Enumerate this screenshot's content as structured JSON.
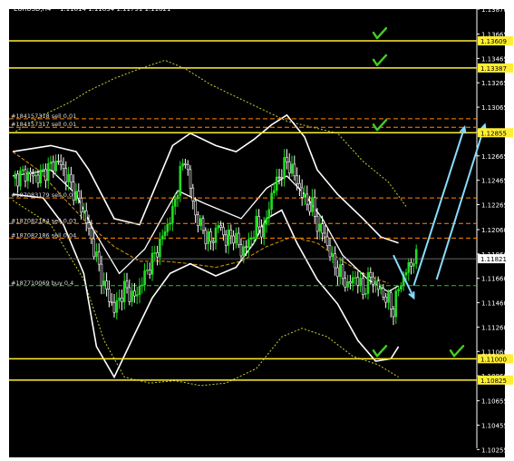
{
  "header": {
    "symbol": "EURUSD,H4",
    "ohlc": "1.11814 1.11834 1.11791 1.11821"
  },
  "colors": {
    "background": "#000000",
    "bull_candle": "#22dd22",
    "bear_candle": "#ffffff",
    "level_line": "#ffee33",
    "order_line_sell": "#ff8800",
    "order_line_buy": "#33bb33",
    "band_main": "#ffffff",
    "band_outer": "#cccc33",
    "moving_average": "#dd9900",
    "arrow": "#88ddff",
    "check": "#44cc22",
    "price_tag": "#ffee33",
    "current_tag": "#ffffff"
  },
  "chart_data": {
    "type": "candlestick",
    "symbol": "EURUSD",
    "timeframe": "H4",
    "grid": false,
    "ylim": [
      1.10265,
      1.1387
    ],
    "y_ticks": [
      "1.13870",
      "1.13665",
      "1.13465",
      "1.13265",
      "1.13065",
      "1.12865",
      "1.12665",
      "1.12465",
      "1.12265",
      "1.12060",
      "1.11860",
      "1.11660",
      "1.11460",
      "1.11260",
      "1.11060",
      "1.10860",
      "1.10655",
      "1.10455",
      "1.10255"
    ],
    "horizontal_levels": [
      {
        "label": "1.13609",
        "price": 1.13609,
        "checked": true
      },
      {
        "label": "1.13387",
        "price": 1.13387,
        "checked": true
      },
      {
        "label": "1.12855",
        "price": 1.12855,
        "checked": true
      },
      {
        "label": "1.11000",
        "price": 1.11,
        "checked": true
      },
      {
        "label": "1.10825",
        "price": 1.10825,
        "checked": false
      }
    ],
    "current_price": {
      "label": "1.11821",
      "price": 1.11821
    },
    "orders": [
      {
        "label": "#184157318 sell 0.01",
        "price": 1.1297
      },
      {
        "label": "#184157317 sell 0.01",
        "price": 1.129
      },
      {
        "label": "#187083179 sell 0.02",
        "price": 1.1232
      },
      {
        "label": "#187082184 sell 0.03",
        "price": 1.1211
      },
      {
        "label": "#187082186 sell 0.04",
        "price": 1.1199
      },
      {
        "label": "#187710069 buy 0.4",
        "price": 1.116
      }
    ],
    "close_path": [
      [
        0,
        1.1248
      ],
      [
        5,
        1.1252
      ],
      [
        10,
        1.1249
      ],
      [
        15,
        1.1258
      ],
      [
        18,
        1.1262
      ],
      [
        20,
        1.1255
      ],
      [
        24,
        1.1238
      ],
      [
        28,
        1.122
      ],
      [
        32,
        1.119
      ],
      [
        36,
        1.116
      ],
      [
        40,
        1.114
      ],
      [
        44,
        1.1158
      ],
      [
        48,
        1.115
      ],
      [
        52,
        1.1168
      ],
      [
        56,
        1.1185
      ],
      [
        60,
        1.1205
      ],
      [
        63,
        1.122
      ],
      [
        66,
        1.1252
      ],
      [
        68,
        1.1265
      ],
      [
        70,
        1.124
      ],
      [
        72,
        1.1218
      ],
      [
        75,
        1.1205
      ],
      [
        78,
        1.1195
      ],
      [
        81,
        1.121
      ],
      [
        84,
        1.1198
      ],
      [
        87,
        1.1202
      ],
      [
        90,
        1.1188
      ],
      [
        93,
        1.1195
      ],
      [
        96,
        1.121
      ],
      [
        99,
        1.1205
      ],
      [
        102,
        1.1235
      ],
      [
        105,
        1.125
      ],
      [
        108,
        1.1262
      ],
      [
        110,
        1.1255
      ],
      [
        112,
        1.1245
      ],
      [
        115,
        1.123
      ],
      [
        118,
        1.1225
      ],
      [
        120,
        1.121
      ],
      [
        123,
        1.12
      ],
      [
        126,
        1.118
      ],
      [
        129,
        1.117
      ],
      [
        132,
        1.116
      ],
      [
        135,
        1.1168
      ],
      [
        138,
        1.1155
      ],
      [
        141,
        1.1168
      ],
      [
        144,
        1.1158
      ],
      [
        147,
        1.115
      ],
      [
        150,
        1.114
      ],
      [
        152,
        1.1158
      ],
      [
        155,
        1.1172
      ],
      [
        158,
        1.1182
      ]
    ],
    "band_upper": [
      [
        0,
        1.127
      ],
      [
        15,
        1.1275
      ],
      [
        25,
        1.127
      ],
      [
        30,
        1.1255
      ],
      [
        40,
        1.1215
      ],
      [
        50,
        1.121
      ],
      [
        58,
        1.125
      ],
      [
        63,
        1.1275
      ],
      [
        70,
        1.1285
      ],
      [
        80,
        1.1275
      ],
      [
        88,
        1.127
      ],
      [
        95,
        1.128
      ],
      [
        102,
        1.1292
      ],
      [
        108,
        1.13
      ],
      [
        115,
        1.1282
      ],
      [
        120,
        1.1255
      ],
      [
        128,
        1.1235
      ],
      [
        138,
        1.1215
      ],
      [
        145,
        1.12
      ],
      [
        152,
        1.1195
      ]
    ],
    "band_middle": [
      [
        0,
        1.125
      ],
      [
        15,
        1.1255
      ],
      [
        25,
        1.1235
      ],
      [
        32,
        1.1205
      ],
      [
        42,
        1.117
      ],
      [
        52,
        1.119
      ],
      [
        60,
        1.122
      ],
      [
        65,
        1.1238
      ],
      [
        75,
        1.1228
      ],
      [
        90,
        1.1215
      ],
      [
        100,
        1.124
      ],
      [
        108,
        1.125
      ],
      [
        115,
        1.1235
      ],
      [
        122,
        1.1215
      ],
      [
        130,
        1.1185
      ],
      [
        140,
        1.1165
      ],
      [
        148,
        1.1155
      ],
      [
        152,
        1.116
      ]
    ],
    "band_lower": [
      [
        0,
        1.1235
      ],
      [
        12,
        1.1232
      ],
      [
        20,
        1.121
      ],
      [
        28,
        1.117
      ],
      [
        33,
        1.111
      ],
      [
        40,
        1.1085
      ],
      [
        48,
        1.112
      ],
      [
        55,
        1.115
      ],
      [
        62,
        1.117
      ],
      [
        70,
        1.1178
      ],
      [
        80,
        1.1168
      ],
      [
        88,
        1.1175
      ],
      [
        95,
        1.1195
      ],
      [
        100,
        1.1215
      ],
      [
        106,
        1.1222
      ],
      [
        112,
        1.1195
      ],
      [
        120,
        1.1165
      ],
      [
        128,
        1.1145
      ],
      [
        136,
        1.1115
      ],
      [
        143,
        1.1098
      ],
      [
        149,
        1.11
      ],
      [
        152,
        1.111
      ]
    ],
    "envelope_upper": [
      [
        0,
        1.1285
      ],
      [
        12,
        1.13
      ],
      [
        22,
        1.131
      ],
      [
        30,
        1.132
      ],
      [
        40,
        1.133
      ],
      [
        50,
        1.1338
      ],
      [
        60,
        1.1345
      ],
      [
        68,
        1.1338
      ],
      [
        78,
        1.1325
      ],
      [
        88,
        1.1315
      ],
      [
        98,
        1.1305
      ],
      [
        108,
        1.1295
      ],
      [
        118,
        1.129
      ],
      [
        128,
        1.1285
      ],
      [
        138,
        1.1262
      ],
      [
        148,
        1.1245
      ],
      [
        155,
        1.1225
      ]
    ],
    "envelope_lower": [
      [
        0,
        1.123
      ],
      [
        15,
        1.121
      ],
      [
        28,
        1.1165
      ],
      [
        36,
        1.1115
      ],
      [
        44,
        1.1085
      ],
      [
        54,
        1.108
      ],
      [
        64,
        1.1082
      ],
      [
        74,
        1.1078
      ],
      [
        84,
        1.108
      ],
      [
        96,
        1.1092
      ],
      [
        106,
        1.1118
      ],
      [
        114,
        1.1125
      ],
      [
        124,
        1.1118
      ],
      [
        134,
        1.1102
      ],
      [
        144,
        1.1095
      ],
      [
        152,
        1.1085
      ]
    ],
    "moving_average": [
      [
        0,
        1.127
      ],
      [
        10,
        1.1255
      ],
      [
        20,
        1.1232
      ],
      [
        30,
        1.121
      ],
      [
        40,
        1.1192
      ],
      [
        50,
        1.118
      ],
      [
        60,
        1.118
      ],
      [
        70,
        1.1178
      ],
      [
        80,
        1.1175
      ],
      [
        90,
        1.118
      ],
      [
        100,
        1.1192
      ],
      [
        110,
        1.12
      ],
      [
        120,
        1.1195
      ],
      [
        130,
        1.118
      ],
      [
        140,
        1.1168
      ],
      [
        148,
        1.1162
      ]
    ],
    "forecast_arrows": [
      {
        "from": [
          1.1165
        ],
        "to": [
          1.1292
        ],
        "direction": "up"
      },
      {
        "from": [
          1.116
        ],
        "to": [
          1.129
        ],
        "direction": "up"
      },
      {
        "from": [
          1.1185
        ],
        "to": [
          1.115
        ],
        "direction": "down"
      }
    ]
  }
}
